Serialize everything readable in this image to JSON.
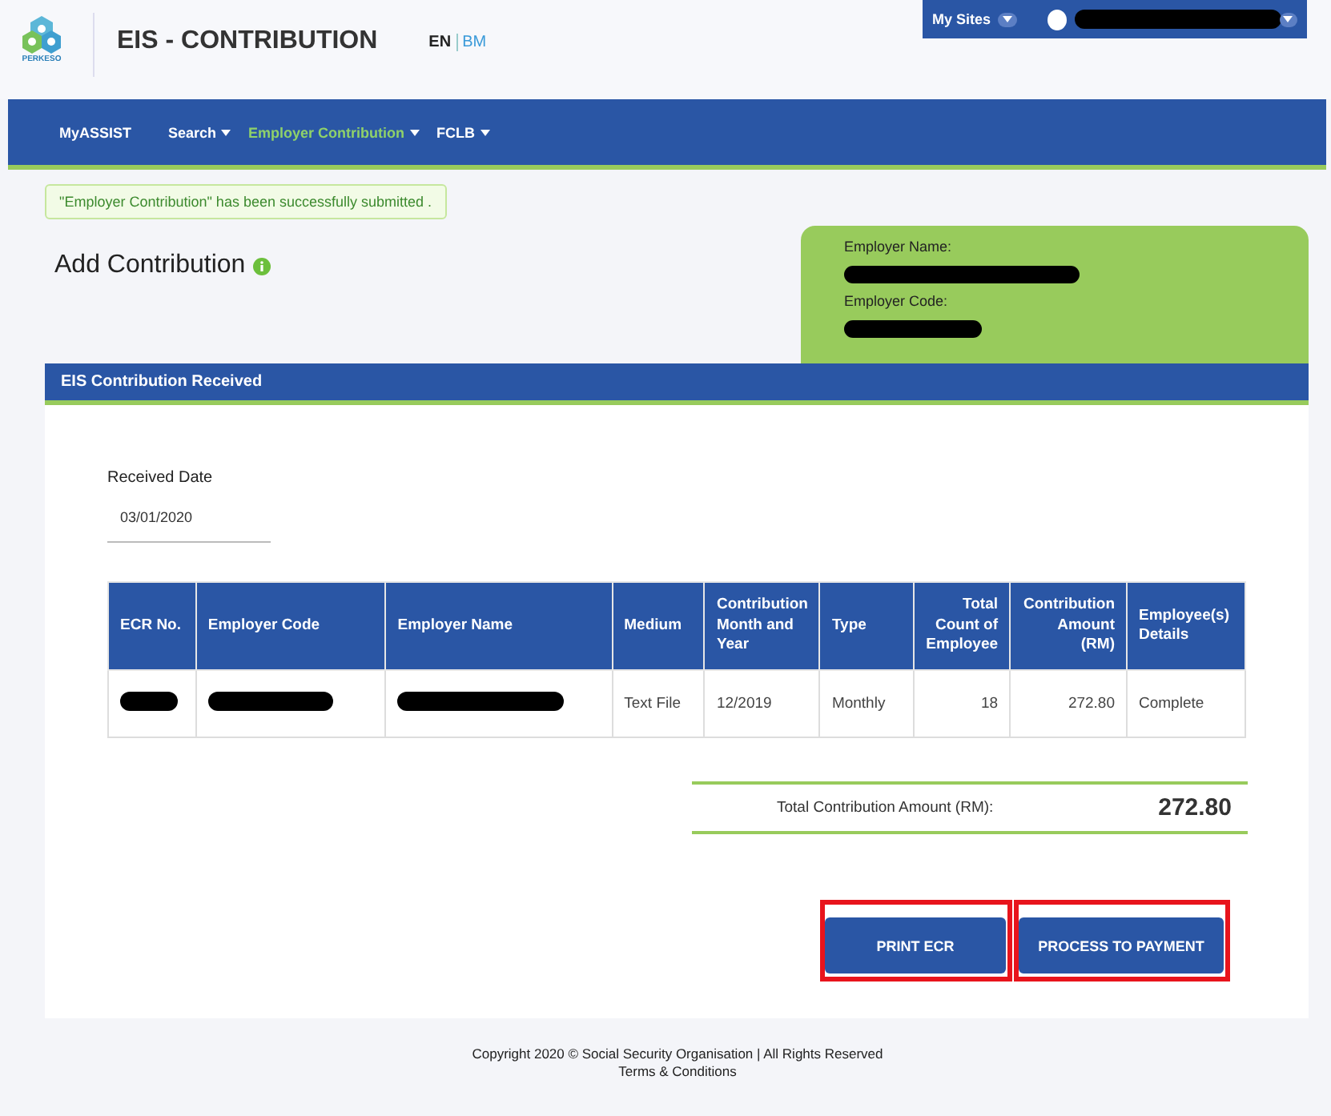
{
  "header": {
    "logo_text": "PERKESO",
    "title": "EIS - CONTRIBUTION",
    "languages": [
      {
        "label": "EN",
        "selected": true
      },
      {
        "label": "BM",
        "selected": false
      }
    ],
    "my_sites": "My Sites",
    "user_name_redacted": true
  },
  "nav": [
    {
      "label": "MyASSIST",
      "selected": false,
      "has_menu": false
    },
    {
      "label": "Search",
      "selected": false,
      "has_menu": true
    },
    {
      "label": "Employer Contribution",
      "selected": true,
      "has_menu": true
    },
    {
      "label": "FCLB",
      "selected": false,
      "has_menu": true
    }
  ],
  "notice": "\"Employer Contribution\" has been successfully submitted .",
  "page_title": "Add Contribution",
  "employer_card": [
    {
      "label": "Employer Name:",
      "redacted": true
    },
    {
      "label": "Employer Code:",
      "redacted": true
    }
  ],
  "section_title": "EIS Contribution Received",
  "received_date": {
    "label": "Received Date",
    "value": "03/01/2020"
  },
  "table": {
    "columns": [
      {
        "label": "ECR No.",
        "numeric": false
      },
      {
        "label": "Employer Code",
        "numeric": false
      },
      {
        "label": "Employer Name",
        "numeric": false
      },
      {
        "label": "Medium",
        "numeric": false
      },
      {
        "label": "Contribution Month and Year",
        "numeric": false
      },
      {
        "label": "Type",
        "numeric": false
      },
      {
        "label": "Total Count of Employee",
        "numeric": true
      },
      {
        "label": "Contribution Amount (RM)",
        "numeric": true
      },
      {
        "label": "Employee(s) Details",
        "numeric": false
      }
    ],
    "rows": [
      [
        {
          "kind": "redacted"
        },
        {
          "kind": "redacted"
        },
        {
          "kind": "redacted"
        },
        {
          "kind": "text",
          "text": "Text File"
        },
        {
          "kind": "text",
          "text": "12/2019"
        },
        {
          "kind": "text",
          "text": "Monthly"
        },
        {
          "kind": "text",
          "text": "18"
        },
        {
          "kind": "text",
          "text": "272.80"
        },
        {
          "kind": "text",
          "text": "Complete"
        }
      ]
    ]
  },
  "total": {
    "label": "Total Contribution Amount (RM):",
    "value": "272.80"
  },
  "buttons": [
    {
      "label": "PRINT ECR",
      "highlighted": true
    },
    {
      "label": "PROCESS TO PAYMENT",
      "highlighted": true
    }
  ],
  "footer": {
    "copyright": "Copyright 2020 © Social Security Organisation | All Rights Reserved",
    "link": "Terms & Conditions"
  }
}
